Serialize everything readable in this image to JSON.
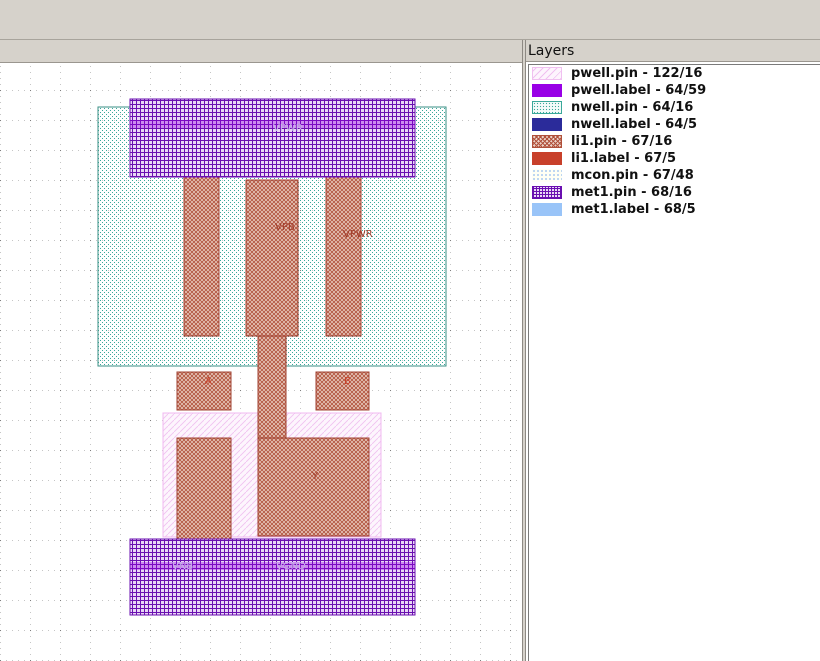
{
  "panels": {
    "layers_title": "Layers"
  },
  "layers": [
    {
      "label": "pwell.pin - 122/16",
      "color": "#f0c0f0",
      "pattern": "hatch-light",
      "icon": "pwell-pin-swatch-icon"
    },
    {
      "label": "pwell.label - 64/59",
      "color": "#9900e6",
      "pattern": "solid",
      "icon": "pwell-label-swatch-icon"
    },
    {
      "label": "nwell.pin - 64/16",
      "color": "#3aa89a",
      "pattern": "dots",
      "icon": "nwell-pin-swatch-icon"
    },
    {
      "label": "nwell.label - 64/5",
      "color": "#2b2b9a",
      "pattern": "solid",
      "icon": "nwell-label-swatch-icon"
    },
    {
      "label": "li1.pin - 67/16",
      "color": "#b0503a",
      "pattern": "crosshatch",
      "icon": "li1-pin-swatch-icon"
    },
    {
      "label": "li1.label - 67/5",
      "color": "#c8402a",
      "pattern": "solid",
      "icon": "li1-label-swatch-icon"
    },
    {
      "label": "mcon.pin - 67/48",
      "color": "#a8c8f0",
      "pattern": "dots-sparse",
      "icon": "mcon-pin-swatch-icon"
    },
    {
      "label": "met1.pin - 68/16",
      "color": "#6a0fb0",
      "pattern": "grid",
      "icon": "met1-pin-swatch-icon"
    },
    {
      "label": "met1.label - 68/5",
      "color": "#99c4f8",
      "pattern": "solid",
      "icon": "met1-label-swatch-icon"
    }
  ],
  "layout": {
    "labels": {
      "vpwr_top": "VPWR",
      "vpb": "VPB",
      "vpwr_right": "VPWR",
      "a": "A",
      "b": "B",
      "y": "Y",
      "vnb": "VNB",
      "vgnd": "VGND"
    }
  }
}
